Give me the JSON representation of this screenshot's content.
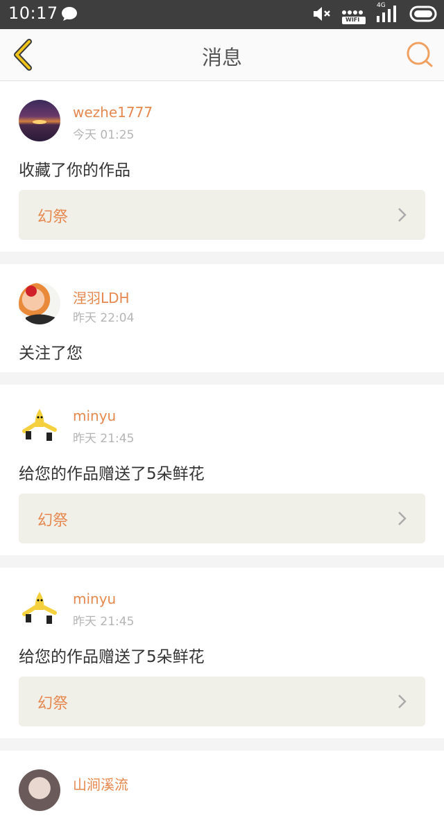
{
  "status_bar": {
    "time": "10:17",
    "network": "4G",
    "wifi_label": "WIFI",
    "icons": [
      "chat-bubble-icon",
      "mute-icon",
      "wifi-icon",
      "signal-icon",
      "battery-icon"
    ]
  },
  "header": {
    "title": "消息",
    "back_icon": "chevron-left-icon",
    "search_icon": "search-icon",
    "accent_color": "#e5884f",
    "back_color": "#f0c419"
  },
  "messages": [
    {
      "username": "wezhe1777",
      "time": "今天 01:25",
      "text": "收藏了你的作品",
      "work": "幻祭"
    },
    {
      "username": "涅羽LDH",
      "time": "昨天 22:04",
      "text": "关注了您"
    },
    {
      "username": "minyu",
      "time": "昨天 21:45",
      "text": "给您的作品赠送了5朵鲜花",
      "work": "幻祭"
    },
    {
      "username": "minyu",
      "time": "昨天 21:45",
      "text": "给您的作品赠送了5朵鲜花",
      "work": "幻祭"
    },
    {
      "username": "山涧溪流"
    }
  ]
}
